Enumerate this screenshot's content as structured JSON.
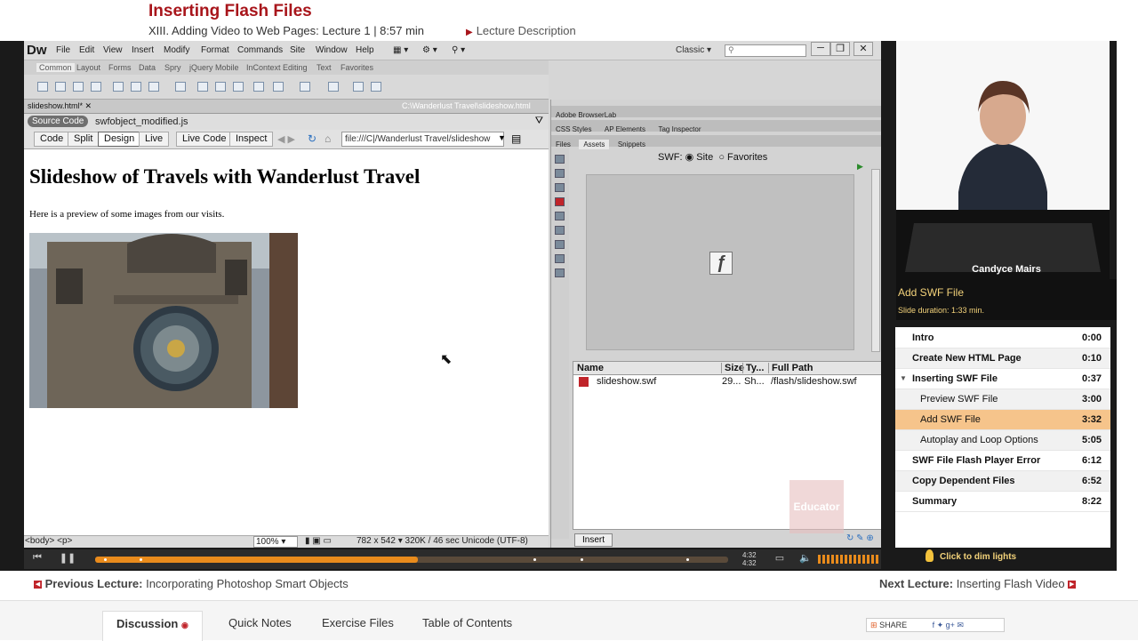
{
  "header": {
    "title": "Inserting Flash Files",
    "subtitle": "XIII. Adding Video to Web Pages: Lecture 1 | 8:57 min",
    "lecture_description": "Lecture Description"
  },
  "dw": {
    "logo": "Dw",
    "menu": [
      "File",
      "Edit",
      "View",
      "Insert",
      "Modify",
      "Format",
      "Commands",
      "Site",
      "Window",
      "Help"
    ],
    "workspace": "Classic",
    "insert_tabs": [
      "Common",
      "Layout",
      "Forms",
      "Data",
      "Spry",
      "jQuery Mobile",
      "InContext Editing",
      "Text",
      "Favorites"
    ],
    "doc_tab": "slideshow.html*",
    "doc_path": "C:\\Wanderlust Travel\\slideshow.html",
    "source_code": "Source Code",
    "related_files": "swfobject_modified.js",
    "view_buttons": {
      "code": "Code",
      "split": "Split",
      "design": "Design",
      "live": "Live",
      "live_code": "Live Code",
      "inspect": "Inspect"
    },
    "address": "file:///C|/Wanderlust Travel/slideshow",
    "page_heading": "Slideshow of Travels with Wanderlust Travel",
    "page_paragraph": "Here is a preview of some images from our visits.",
    "status_tag": "<body> <p>",
    "zoom": "100%",
    "status_info": "782 x 542 ▾ 320K / 46 sec  Unicode (UTF-8)",
    "panels": {
      "browserlab": "Adobe BrowserLab",
      "css_tabs": [
        "CSS Styles",
        "AP Elements",
        "Tag Inspector"
      ],
      "files_tabs": [
        "Files",
        "Assets",
        "Snippets"
      ],
      "swf_label": "SWF:",
      "site": "Site",
      "favorites": "Favorites",
      "columns": [
        "Name",
        "Size",
        "Ty...",
        "Full Path"
      ],
      "row": [
        "slideshow.swf",
        "29...",
        "Sh...",
        "/flash/slideshow.swf"
      ],
      "insert": "Insert",
      "watermark": "Educator"
    }
  },
  "instructor": {
    "name": "Candyce Mairs"
  },
  "slide": {
    "title": "Add SWF File",
    "duration": "Slide duration: 1:33 min."
  },
  "chapters": [
    {
      "name": "Intro",
      "time": "0:00"
    },
    {
      "name": "Create New HTML Page",
      "time": "0:10"
    },
    {
      "name": "Inserting SWF File",
      "time": "0:37"
    },
    {
      "name": "Preview SWF File",
      "time": "3:00"
    },
    {
      "name": "Add SWF File",
      "time": "3:32"
    },
    {
      "name": "Autoplay and Loop Options",
      "time": "5:05"
    },
    {
      "name": "SWF File Flash Player Error",
      "time": "6:12"
    },
    {
      "name": "Copy Dependent Files",
      "time": "6:52"
    },
    {
      "name": "Summary",
      "time": "8:22"
    }
  ],
  "dim_lights": "Click to dim lights",
  "player": {
    "current": "4:32",
    "duration": "4:32",
    "progress": 0.51
  },
  "nav": {
    "prev_label": "Previous Lecture:",
    "prev_title": "Incorporating Photoshop Smart Objects",
    "next_label": "Next Lecture:",
    "next_title": "Inserting Flash Video"
  },
  "tabs": [
    "Discussion",
    "Quick Notes",
    "Exercise Files",
    "Table of Contents"
  ],
  "share": "SHARE"
}
